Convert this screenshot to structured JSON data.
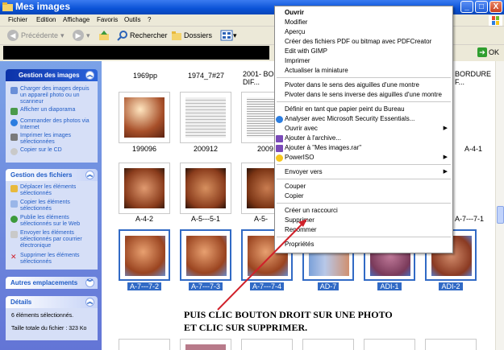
{
  "window": {
    "title": "Mes images",
    "min_label": "_",
    "max_label": "□",
    "close_label": "X"
  },
  "menu": [
    "Fichier",
    "Edition",
    "Affichage",
    "Favoris",
    "Outils",
    "?"
  ],
  "toolbar": {
    "back": "Précédente",
    "search": "Rechercher",
    "folders": "Dossiers"
  },
  "address": {
    "go": "OK"
  },
  "taskpane": {
    "images": {
      "title": "Gestion des images",
      "items": [
        "Charger des images depuis un appareil photo ou un scanneur",
        "Afficher un diaporama",
        "Commander des photos via Internet",
        "Imprimer les images sélectionnées",
        "Copier sur le CD"
      ]
    },
    "files": {
      "title": "Gestion des fichiers",
      "items": [
        "Déplacer les éléments sélectionnés",
        "Copier les éléments sélectionnés",
        "Publie les éléments sélectionnés sur le Web",
        "Envoyer les éléments sélectionnés par courrier électronique",
        "Supprimer les éléments sélectionnés"
      ]
    },
    "other": {
      "title": "Autres emplacements"
    },
    "details": {
      "title": "Détails",
      "count": "6 éléments sélectionnés.",
      "size": "Taille totale du fichier : 323 Ko"
    }
  },
  "content": {
    "top_labels": [
      "1969pp",
      "1974_7#27",
      "2001- BO DIF...",
      "BORDURE F..."
    ],
    "row2": [
      "199096",
      "200912",
      "2009"
    ],
    "row2_right": "A-4-1",
    "row3": [
      "A-4-2",
      "A-5---5-1",
      "A-5-"
    ],
    "row3_right": "A-7---7-1",
    "row4": [
      "A-7---7-2",
      "A-7---7-3",
      "A-7---7-4",
      "AD-7",
      "ADI-1",
      "ADI-2"
    ],
    "instruction_1": "PUIS CLIC BOUTON DROIT SUR UNE PHOTO",
    "instruction_2": "ET CLIC SUR SUPPRIMER."
  },
  "context_menu": {
    "open": "Ouvrir",
    "edit": "Modifier",
    "preview": "Aperçu",
    "pdf": "Créer des fichiers PDF ou bitmap avec PDFCreator",
    "gimp": "Edit with GIMP",
    "print": "Imprimer",
    "thumb": "Actualiser la miniature",
    "rot_cw": "Pivoter dans le sens des aiguilles d'une montre",
    "rot_ccw": "Pivoter dans le sens inverse des aiguilles d'une montre",
    "wallpaper": "Définir en tant que papier peint du Bureau",
    "mse": "Analyser avec Microsoft Security Essentials...",
    "open_with": "Ouvrir avec",
    "add_archive": "Ajouter à l'archive...",
    "add_rar": "Ajouter à \"Mes images.rar\"",
    "poweriso": "PowerISO",
    "send_to": "Envoyer vers",
    "cut": "Couper",
    "copy": "Copier",
    "shortcut": "Créer un raccourci",
    "delete": "Supprimer",
    "rename": "Renommer",
    "properties": "Propriétés"
  },
  "colors": {
    "selection": "#316ac5",
    "arrow": "#d0202a",
    "taskpane_link": "#215dc6"
  }
}
